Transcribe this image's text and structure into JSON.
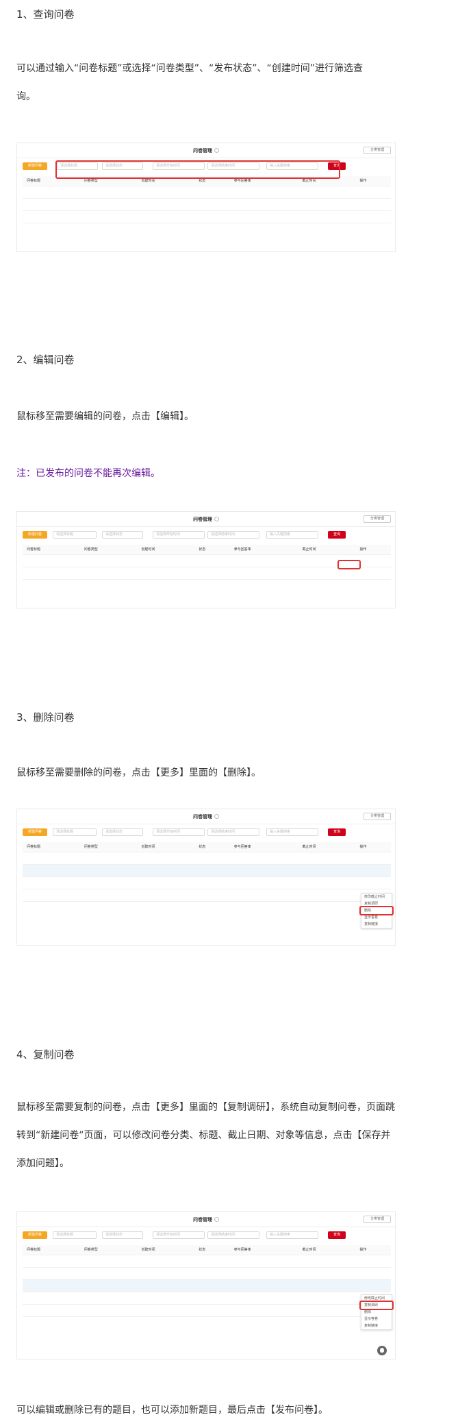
{
  "sections": [
    {
      "heading": "1、查询问卷",
      "paragraphs": [
        "可以通过输入“问卷标题”或选择“问卷类型”、“发布状态”、“创建时间”进行筛选查",
        "询。"
      ]
    },
    {
      "heading": "2、编辑问卷",
      "paragraphs": [
        "鼠标移至需要编辑的问卷，点击【编辑】。"
      ],
      "note": "注：已发布的问卷不能再次编辑。"
    },
    {
      "heading": "3、删除问卷",
      "paragraphs": [
        "鼠标移至需要删除的问卷，点击【更多】里面的【删除】。"
      ]
    },
    {
      "heading": "4、复制问卷",
      "paragraphs": [
        "鼠标移至需要复制的问卷，点击【更多】里面的【复制调研】，系统自动复制问卷，页面跳",
        "转到“新建问卷“页面，可以修改问卷分类、标题、截止日期、对象等信息，点击【保存并",
        "添加问题】。"
      ]
    }
  ],
  "closing": "可以编辑或删除已有的题目，也可以添加新题目，最后点击【发布问卷】。",
  "screenshot": {
    "title": "问卷管理",
    "category_btn": "分类管理",
    "new_btn": "新建问卷",
    "title_placeholder": "请选择标题",
    "type_placeholder": "请选择状态",
    "date_start": "请选择开始时间",
    "date_end": "请选择结束时间",
    "keyword_placeholder": "输入关键搜索",
    "query_btn": "查询",
    "columns": [
      "问卷标题",
      "问卷类型",
      "创建时间",
      "状态",
      "参与回答率",
      "截止时间",
      "操作"
    ],
    "more_menu": [
      "修改截止时间",
      "复制调研",
      "删除",
      "显示答卷",
      "复制链接"
    ]
  },
  "colors": {
    "accent_orange": "#f5a623",
    "query_red": "#d0021b",
    "highlight_red": "#e03030",
    "link_blue": "#3b8fe0",
    "note_purple": "#6a1ba0"
  }
}
